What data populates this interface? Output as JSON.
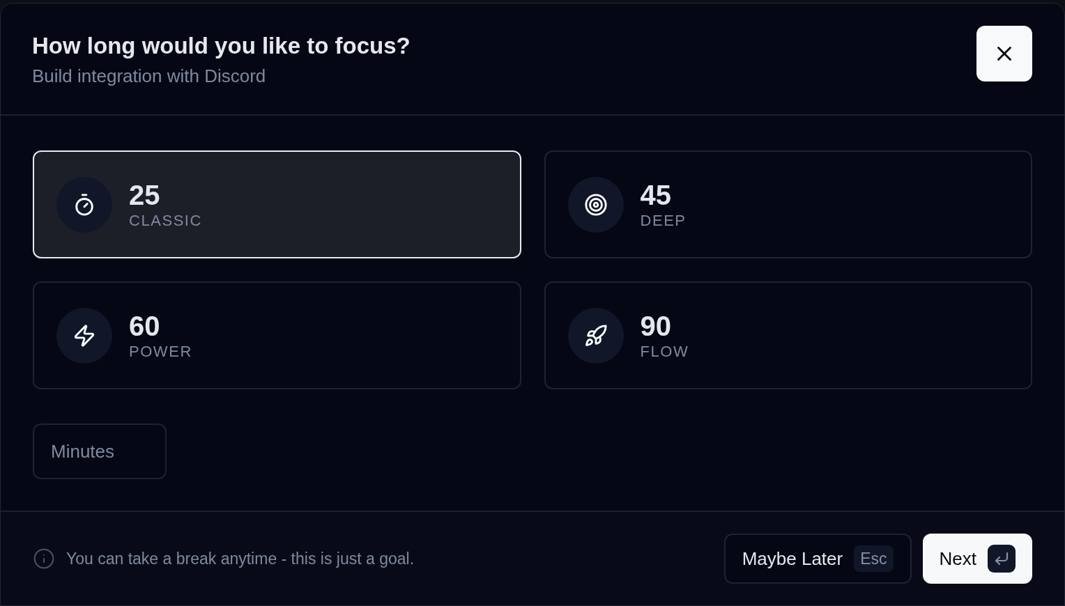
{
  "dialog": {
    "title": "How long would you like to focus?",
    "subtitle": "Build integration with Discord"
  },
  "options": [
    {
      "minutes": "25",
      "label": "CLASSIC",
      "selected": true
    },
    {
      "minutes": "45",
      "label": "DEEP",
      "selected": false
    },
    {
      "minutes": "60",
      "label": "POWER",
      "selected": false
    },
    {
      "minutes": "90",
      "label": "FLOW",
      "selected": false
    }
  ],
  "custom_minutes": {
    "placeholder": "Minutes"
  },
  "footer": {
    "hint": "You can take a break anytime - this is just a goal.",
    "buttons": [
      {
        "kind": "secondary",
        "label": "Maybe Later",
        "shortcut": "Esc"
      },
      {
        "kind": "primary",
        "label": "Next"
      }
    ]
  }
}
